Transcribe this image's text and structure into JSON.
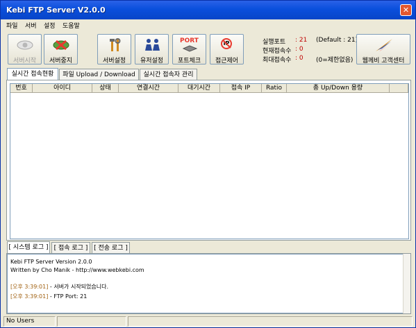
{
  "window": {
    "title": "Kebi FTP Server V2.0.0"
  },
  "menu": [
    "파일",
    "서버",
    "설정",
    "도움말"
  ],
  "toolbar": {
    "start": "서버시작",
    "stop": "서버중지",
    "settings": "서버설정",
    "users": "유저설정",
    "port_check": "포트체크",
    "access": "접근제어",
    "port_icon_text": "PORT",
    "ip_icon_text": "IP",
    "support": "웹께비 고객센터"
  },
  "info": {
    "port_label": "실행포트",
    "port_value": ": 21",
    "port_default": "(Default : 21)",
    "current_label": "현재접속수",
    "current_value": ": 0",
    "max_label": "최대접속수",
    "max_value": ": 0",
    "max_note": "(0=제한없음)"
  },
  "tabs": [
    "실시간 접속현황",
    "파일 Upload / Download 상태",
    "실시간 접속자 관리"
  ],
  "columns": [
    "번호",
    "아이디",
    "상태",
    "연결시간",
    "대기시간",
    "접속 IP",
    "Ratio",
    "총 Up/Down 용량"
  ],
  "log_tabs": [
    "[ 시스템 로그 ]",
    "[ 접속 로그 ]",
    "[ 전송 로그 ]"
  ],
  "log": {
    "line1": "Kebi FTP Server Version 2.0.0",
    "line2": "Written by Cho Manik - http://www.webkebi.com",
    "entries": [
      {
        "ts": "[오후 3:39:01]",
        "msg": " - 서버가 시작되었습니다."
      },
      {
        "ts": "[오후 3:39:01]",
        "msg": " - FTP Port: 21"
      }
    ]
  },
  "status": {
    "users": "No Users"
  },
  "colors": {
    "accent_red": "#e8392f",
    "title_blue": "#0a4fdc",
    "info_red": "#c00000"
  }
}
